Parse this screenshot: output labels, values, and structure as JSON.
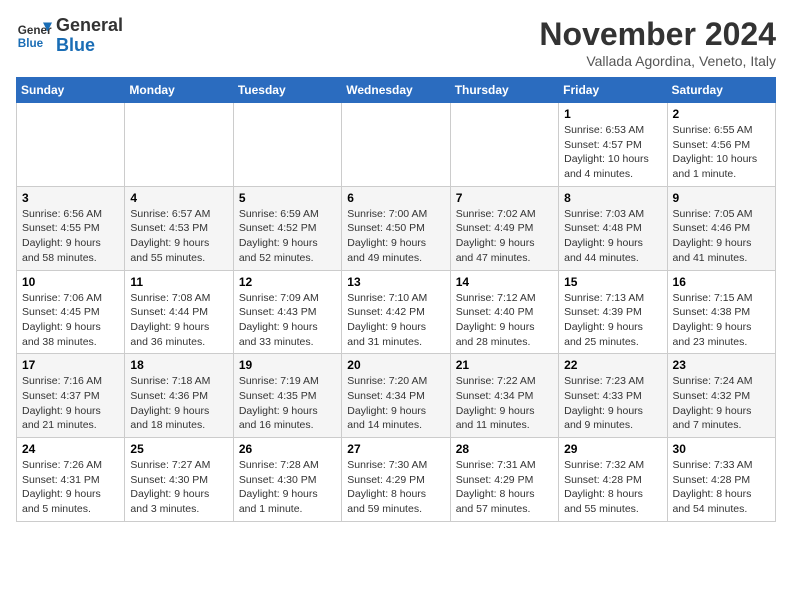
{
  "logo": {
    "line1": "General",
    "line2": "Blue"
  },
  "title": "November 2024",
  "subtitle": "Vallada Agordina, Veneto, Italy",
  "days_of_week": [
    "Sunday",
    "Monday",
    "Tuesday",
    "Wednesday",
    "Thursday",
    "Friday",
    "Saturday"
  ],
  "weeks": [
    [
      {
        "day": "",
        "detail": ""
      },
      {
        "day": "",
        "detail": ""
      },
      {
        "day": "",
        "detail": ""
      },
      {
        "day": "",
        "detail": ""
      },
      {
        "day": "",
        "detail": ""
      },
      {
        "day": "1",
        "detail": "Sunrise: 6:53 AM\nSunset: 4:57 PM\nDaylight: 10 hours and 4 minutes."
      },
      {
        "day": "2",
        "detail": "Sunrise: 6:55 AM\nSunset: 4:56 PM\nDaylight: 10 hours and 1 minute."
      }
    ],
    [
      {
        "day": "3",
        "detail": "Sunrise: 6:56 AM\nSunset: 4:55 PM\nDaylight: 9 hours and 58 minutes."
      },
      {
        "day": "4",
        "detail": "Sunrise: 6:57 AM\nSunset: 4:53 PM\nDaylight: 9 hours and 55 minutes."
      },
      {
        "day": "5",
        "detail": "Sunrise: 6:59 AM\nSunset: 4:52 PM\nDaylight: 9 hours and 52 minutes."
      },
      {
        "day": "6",
        "detail": "Sunrise: 7:00 AM\nSunset: 4:50 PM\nDaylight: 9 hours and 49 minutes."
      },
      {
        "day": "7",
        "detail": "Sunrise: 7:02 AM\nSunset: 4:49 PM\nDaylight: 9 hours and 47 minutes."
      },
      {
        "day": "8",
        "detail": "Sunrise: 7:03 AM\nSunset: 4:48 PM\nDaylight: 9 hours and 44 minutes."
      },
      {
        "day": "9",
        "detail": "Sunrise: 7:05 AM\nSunset: 4:46 PM\nDaylight: 9 hours and 41 minutes."
      }
    ],
    [
      {
        "day": "10",
        "detail": "Sunrise: 7:06 AM\nSunset: 4:45 PM\nDaylight: 9 hours and 38 minutes."
      },
      {
        "day": "11",
        "detail": "Sunrise: 7:08 AM\nSunset: 4:44 PM\nDaylight: 9 hours and 36 minutes."
      },
      {
        "day": "12",
        "detail": "Sunrise: 7:09 AM\nSunset: 4:43 PM\nDaylight: 9 hours and 33 minutes."
      },
      {
        "day": "13",
        "detail": "Sunrise: 7:10 AM\nSunset: 4:42 PM\nDaylight: 9 hours and 31 minutes."
      },
      {
        "day": "14",
        "detail": "Sunrise: 7:12 AM\nSunset: 4:40 PM\nDaylight: 9 hours and 28 minutes."
      },
      {
        "day": "15",
        "detail": "Sunrise: 7:13 AM\nSunset: 4:39 PM\nDaylight: 9 hours and 25 minutes."
      },
      {
        "day": "16",
        "detail": "Sunrise: 7:15 AM\nSunset: 4:38 PM\nDaylight: 9 hours and 23 minutes."
      }
    ],
    [
      {
        "day": "17",
        "detail": "Sunrise: 7:16 AM\nSunset: 4:37 PM\nDaylight: 9 hours and 21 minutes."
      },
      {
        "day": "18",
        "detail": "Sunrise: 7:18 AM\nSunset: 4:36 PM\nDaylight: 9 hours and 18 minutes."
      },
      {
        "day": "19",
        "detail": "Sunrise: 7:19 AM\nSunset: 4:35 PM\nDaylight: 9 hours and 16 minutes."
      },
      {
        "day": "20",
        "detail": "Sunrise: 7:20 AM\nSunset: 4:34 PM\nDaylight: 9 hours and 14 minutes."
      },
      {
        "day": "21",
        "detail": "Sunrise: 7:22 AM\nSunset: 4:34 PM\nDaylight: 9 hours and 11 minutes."
      },
      {
        "day": "22",
        "detail": "Sunrise: 7:23 AM\nSunset: 4:33 PM\nDaylight: 9 hours and 9 minutes."
      },
      {
        "day": "23",
        "detail": "Sunrise: 7:24 AM\nSunset: 4:32 PM\nDaylight: 9 hours and 7 minutes."
      }
    ],
    [
      {
        "day": "24",
        "detail": "Sunrise: 7:26 AM\nSunset: 4:31 PM\nDaylight: 9 hours and 5 minutes."
      },
      {
        "day": "25",
        "detail": "Sunrise: 7:27 AM\nSunset: 4:30 PM\nDaylight: 9 hours and 3 minutes."
      },
      {
        "day": "26",
        "detail": "Sunrise: 7:28 AM\nSunset: 4:30 PM\nDaylight: 9 hours and 1 minute."
      },
      {
        "day": "27",
        "detail": "Sunrise: 7:30 AM\nSunset: 4:29 PM\nDaylight: 8 hours and 59 minutes."
      },
      {
        "day": "28",
        "detail": "Sunrise: 7:31 AM\nSunset: 4:29 PM\nDaylight: 8 hours and 57 minutes."
      },
      {
        "day": "29",
        "detail": "Sunrise: 7:32 AM\nSunset: 4:28 PM\nDaylight: 8 hours and 55 minutes."
      },
      {
        "day": "30",
        "detail": "Sunrise: 7:33 AM\nSunset: 4:28 PM\nDaylight: 8 hours and 54 minutes."
      }
    ]
  ]
}
